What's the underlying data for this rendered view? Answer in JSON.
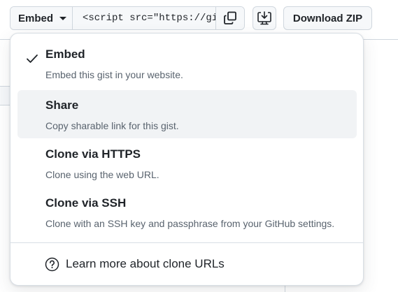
{
  "toolbar": {
    "embed_label": "Embed",
    "clone_url_value": "<script src=\"https://gist.github.com/",
    "download_label": "Download ZIP"
  },
  "menu": {
    "items": [
      {
        "title": "Embed",
        "description": "Embed this gist in your website.",
        "selected": true
      },
      {
        "title": "Share",
        "description": "Copy sharable link for this gist.",
        "selected": false
      },
      {
        "title": "Clone via HTTPS",
        "description": "Clone using the web URL.",
        "selected": false
      },
      {
        "title": "Clone via SSH",
        "description": "Clone with an SSH key and passphrase from your GitHub settings.",
        "selected": false
      }
    ],
    "learn_more": "Learn more about clone URLs"
  },
  "icons": {
    "caret": "triangle-down-icon",
    "copy": "copy-icon",
    "desktop": "desktop-download-icon",
    "check": "check-icon",
    "question": "question-icon"
  },
  "colors": {
    "text_primary": "#1f2328",
    "text_muted": "#59636e",
    "button_bg": "#f6f8fa",
    "border": "#d0d7de",
    "hover_bg": "#f1f3f5"
  }
}
